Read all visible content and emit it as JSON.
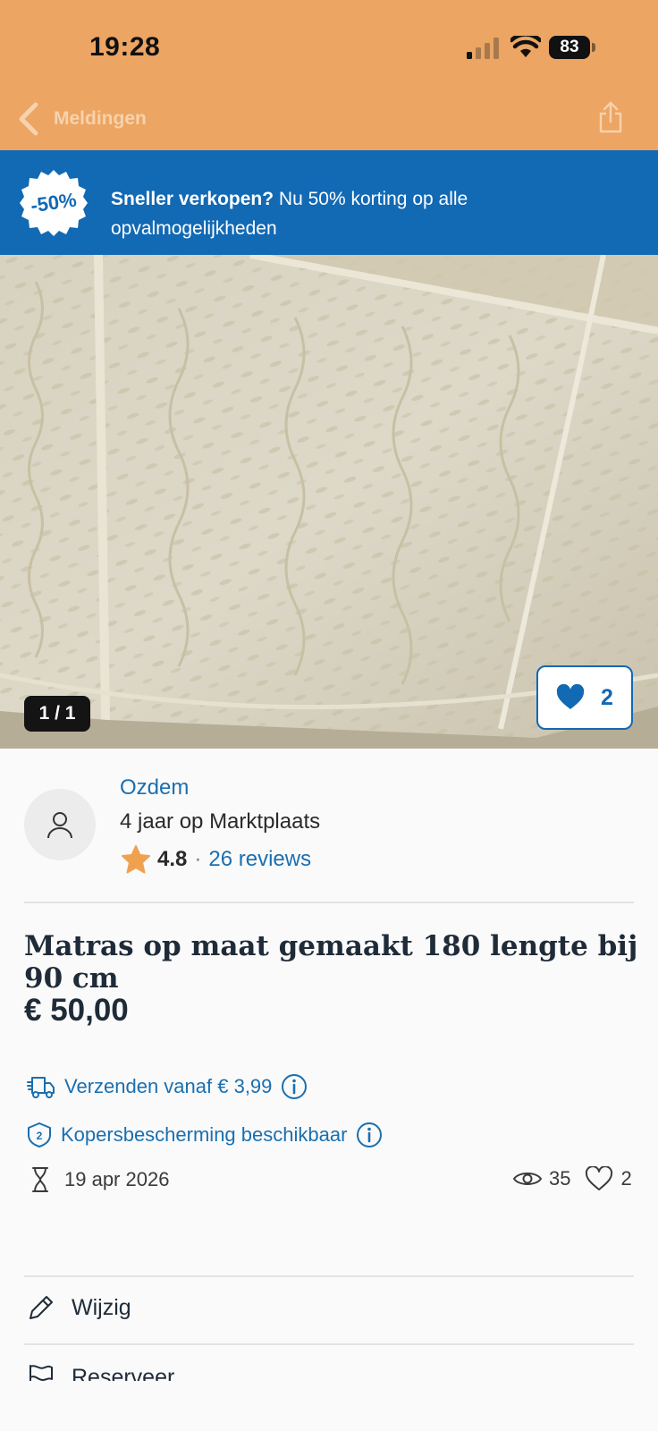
{
  "status_bar": {
    "time": "19:28",
    "battery": "83"
  },
  "nav": {
    "back_label": "Meldingen",
    "share_icon": "share-icon"
  },
  "promo": {
    "badge": "-50%",
    "bold_text": "Sneller verkopen?",
    "text": " Nu 50% korting op alle opvalmogelijkheden"
  },
  "photo": {
    "counter": "1 / 1",
    "favorites": "2"
  },
  "seller": {
    "name": "Ozdem",
    "since": "4 jaar op Marktplaats",
    "rating": "4.8",
    "separator": "·",
    "reviews": "26 reviews"
  },
  "listing": {
    "title": "Matras op maat gemaakt 180 lengte bij 90 cm",
    "price": "€ 50,00",
    "shipping": "Verzenden vanaf € 3,99",
    "protection": "Kopersbescherming beschikbaar",
    "date": "19 apr 2026",
    "views": "35",
    "likes": "2"
  },
  "actions": {
    "edit": "Wijzig",
    "reserve": "Reserveer"
  },
  "colors": {
    "header": "#eca563",
    "brand_blue": "#1269b4",
    "link": "#1a6fb0",
    "star": "#f0a150"
  }
}
